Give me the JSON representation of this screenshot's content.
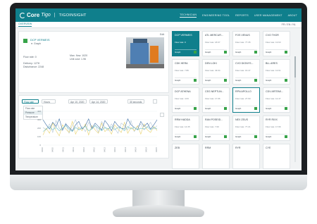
{
  "header": {
    "brand": "Core",
    "brand_suffix": "Tigo",
    "separator": "|",
    "product": "TIGOINSIGHT",
    "nav": [
      "TECHNICIAN",
      "ENGINEERING TOOL",
      "REPORTS",
      "USER MANAGEMENT",
      "ABOUT"
    ]
  },
  "subbar": {
    "tab": "OVERVIEW",
    "language": "FR / EN / NL"
  },
  "detail": {
    "name": "DCP VERMEIS",
    "status": "Graph",
    "edit": "Edit",
    "left_fields": [
      "Flow rate: 0",
      "Delivery: 1278",
      "Disturbance: 2248"
    ],
    "right_fields": [
      "Max. flow: 1020",
      "Unit cost: 1.96"
    ]
  },
  "chart": {
    "selector": "Flow rate",
    "interval": "Hours",
    "date_from": "Apr 10, 2020",
    "date_to": "Apr 14, 2020",
    "range": "30 seconds",
    "dropdown_options": [
      "Flow rate",
      "Pressure",
      "Temperature"
    ],
    "ytick_labels": [
      "400",
      "300",
      "200",
      "100",
      "0"
    ],
    "xtick_labels": [
      "04/10",
      "04/10",
      "04/11",
      "04/11",
      "04/12",
      "04/12",
      "04/13",
      "04/13",
      "04/14",
      "04/14",
      "04/14",
      "04/15"
    ],
    "colors": [
      "#b5c8d8",
      "#e7d26d",
      "#3f6fa6",
      "#6cc0c8"
    ]
  },
  "chart_data": {
    "type": "line",
    "x": [
      0,
      1,
      2,
      3,
      4,
      5,
      6,
      7,
      8,
      9,
      10,
      11,
      12,
      13,
      14,
      15,
      16,
      17,
      18,
      19,
      20,
      21,
      22,
      23,
      24,
      25,
      26,
      27,
      28,
      29,
      30,
      31,
      32,
      33,
      34,
      35
    ],
    "ylim": [
      0,
      400
    ],
    "series": [
      {
        "values": [
          210,
          180,
          250,
          150,
          290,
          200,
          170,
          260,
          140,
          230,
          300,
          180,
          220,
          160,
          270,
          190,
          240,
          150,
          280,
          210,
          170,
          250,
          200,
          140,
          260,
          230,
          180,
          290,
          160,
          220,
          250,
          180,
          210,
          270,
          190,
          230
        ]
      },
      {
        "values": [
          120,
          200,
          140,
          260,
          170,
          110,
          240,
          190,
          150,
          280,
          130,
          210,
          170,
          250,
          120,
          230,
          180,
          140,
          260,
          160,
          200,
          130,
          240,
          190,
          150,
          270,
          140,
          210,
          170,
          230,
          130,
          250,
          180,
          150,
          220,
          170
        ]
      },
      {
        "values": [
          300,
          240,
          190,
          270,
          220,
          310,
          180,
          250,
          210,
          170,
          240,
          280,
          190,
          230,
          310,
          200,
          260,
          220,
          180,
          290,
          240,
          170,
          280,
          230,
          200,
          190,
          310,
          240,
          210,
          180,
          280,
          220,
          260,
          190,
          240,
          300
        ]
      },
      {
        "values": [
          160,
          190,
          220,
          180,
          210,
          170,
          200,
          230,
          190,
          160,
          210,
          180,
          200,
          220,
          170,
          190,
          230,
          200,
          170,
          210,
          190,
          220,
          180,
          210,
          200,
          170,
          220,
          190,
          210,
          180,
          200,
          190,
          220,
          180,
          210,
          190
        ]
      }
    ]
  },
  "cards": [
    {
      "name": "DCP VERMEIS",
      "rate": "Flow rate: 0",
      "status": "Graph",
      "style": "selected"
    },
    {
      "name": "ATL MERCUR...",
      "rate": "Flow rate: 18.67",
      "status": "Graph",
      "style": "default"
    },
    {
      "name": "FOS VENUS",
      "rate": "Flow rate: 77.35",
      "status": "Graph",
      "style": "default"
    },
    {
      "name": "CVO THOR",
      "rate": "Flow rate: 13.63",
      "status": "Graph",
      "style": "default"
    },
    {
      "name": "CDK HERA",
      "rate": "Flow rate: 7.89",
      "status": "Graph",
      "style": "default"
    },
    {
      "name": "DEN LOKI",
      "rate": "Flow rate: 43.64",
      "status": "Graph",
      "style": "default"
    },
    {
      "name": "CVO DIONYS...",
      "rate": "Flow rate: 16.47",
      "status": "Graph",
      "style": "default"
    },
    {
      "name": "BLL ARES",
      "rate": "Flow rate: 13.61",
      "status": "Graph",
      "style": "default"
    },
    {
      "name": "DCP ATHENA",
      "rate": "Flow rate: 4.63",
      "status": "Graph",
      "style": "default"
    },
    {
      "name": "CEG NEPTUN...",
      "rate": "Flow rate: 17.96",
      "status": "Graph",
      "style": "default"
    },
    {
      "name": "RPN APOLLO",
      "rate": "Flow rate: 27.60",
      "status": "Graph",
      "style": "outlined"
    },
    {
      "name": "CDV ARTEMI...",
      "rate": "Flow rate: 12.47",
      "status": "Graph",
      "style": "default"
    },
    {
      "name": "RRM HADDA",
      "rate": "Flow rate: 14.35",
      "status": "Graph",
      "style": "default"
    },
    {
      "name": "RAN POSEID...",
      "rate": "Flow rate: 7.00",
      "status": "Graph",
      "style": "default"
    },
    {
      "name": "NEX ZEUS",
      "rate": "Flow rate: 77.21",
      "status": "Graph",
      "style": "default"
    },
    {
      "name": "RYR RIXX",
      "rate": "Flow rate: 17.96",
      "status": "Graph",
      "style": "default"
    },
    {
      "name": "ZEB",
      "rate": "",
      "status": "",
      "style": "default"
    },
    {
      "name": "RRM",
      "rate": "",
      "status": "",
      "style": "default"
    },
    {
      "name": "RYR",
      "rate": "",
      "status": "",
      "style": "default"
    },
    {
      "name": "CYE",
      "rate": "",
      "status": "",
      "style": "default"
    }
  ]
}
